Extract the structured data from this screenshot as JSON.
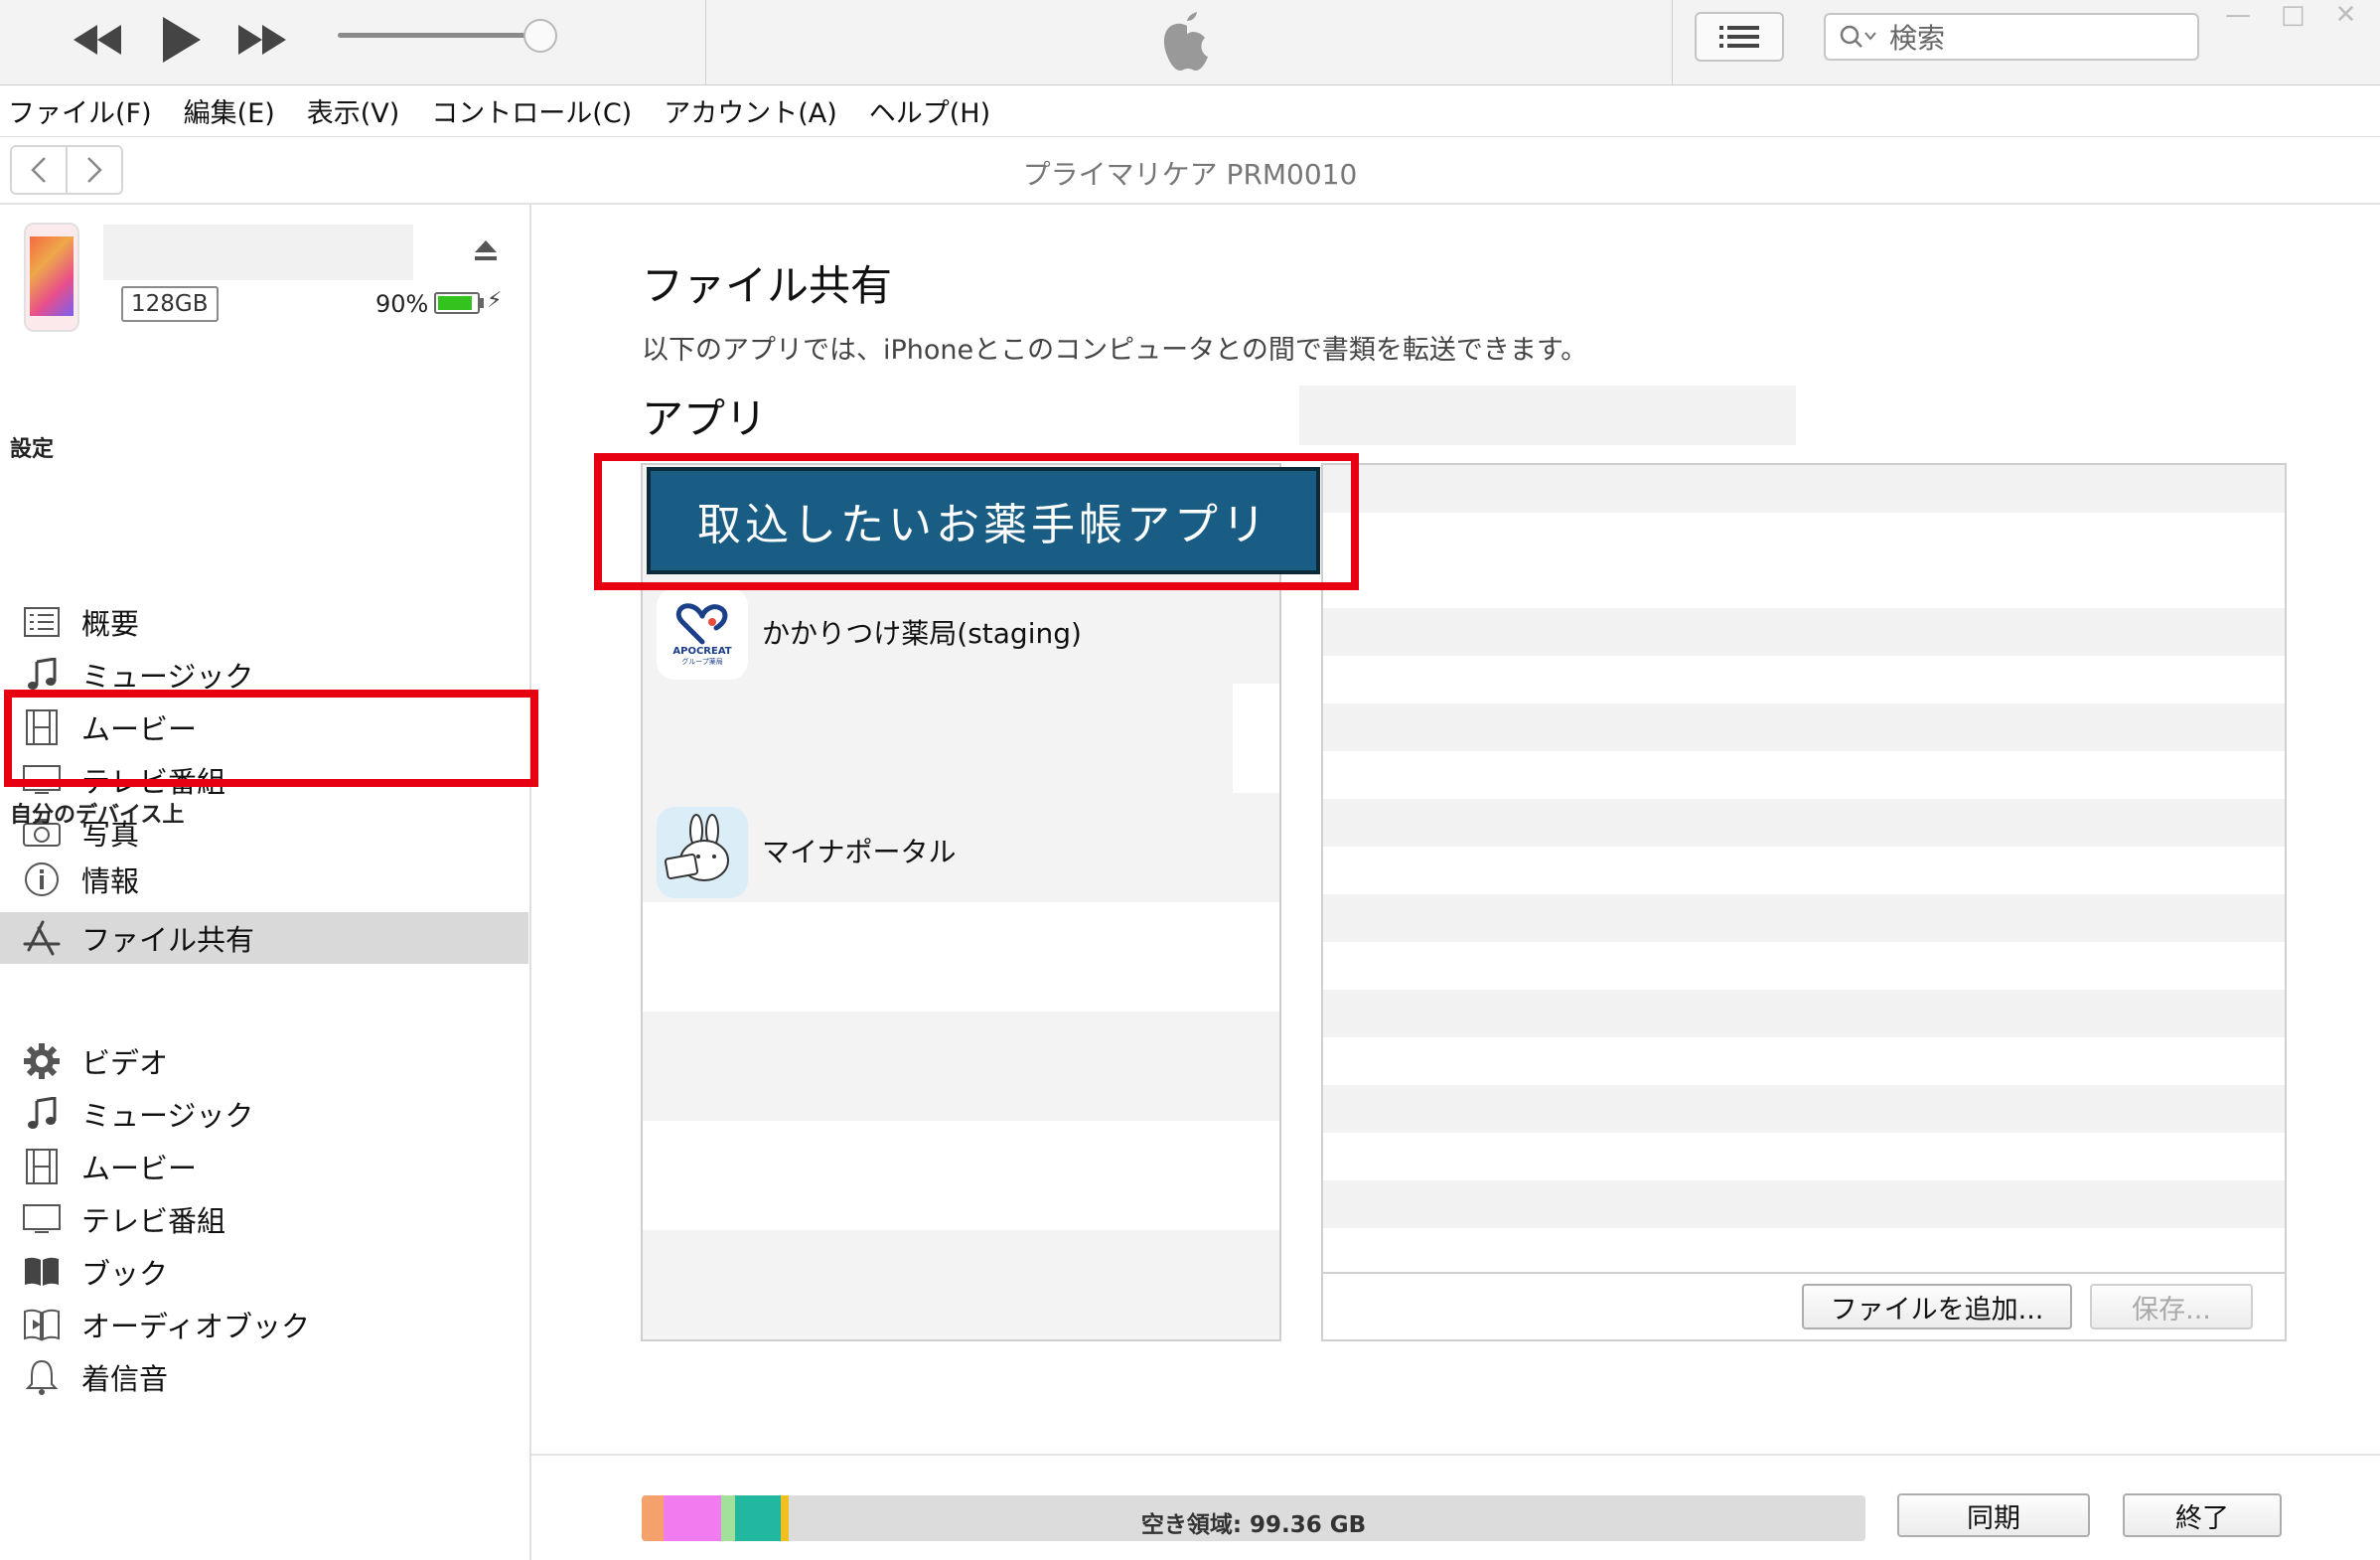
{
  "window": {
    "search_placeholder": "検索",
    "controls": [
      "—",
      "□",
      "✕"
    ]
  },
  "menu": [
    "ファイル(F)",
    "編集(E)",
    "表示(V)",
    "コントロール(C)",
    "アカウント(A)",
    "ヘルプ(H)"
  ],
  "nav": {
    "device_title": "プライマリケア PRM0010"
  },
  "device": {
    "capacity": "128GB",
    "battery": "90%",
    "battery_level": 0.9
  },
  "sidebar": {
    "settings_head": "設定",
    "settings_items": [
      {
        "label": "概要",
        "icon": "summary-icon"
      },
      {
        "label": "ミュージック",
        "icon": "music-icon"
      },
      {
        "label": "ムービー",
        "icon": "film-icon"
      },
      {
        "label": "テレビ番組",
        "icon": "tv-icon"
      },
      {
        "label": "写真",
        "icon": "camera-icon"
      },
      {
        "label": "情報",
        "icon": "info-icon"
      },
      {
        "label": "ファイル共有",
        "icon": "appstore-icon"
      }
    ],
    "device_head": "自分のデバイス上",
    "device_items": [
      {
        "label": "ビデオ",
        "icon": "gear-icon"
      },
      {
        "label": "ミュージック",
        "icon": "music-icon"
      },
      {
        "label": "ムービー",
        "icon": "film-icon"
      },
      {
        "label": "テレビ番組",
        "icon": "tv-icon"
      },
      {
        "label": "ブック",
        "icon": "book-icon"
      },
      {
        "label": "オーディオブック",
        "icon": "audiobook-icon"
      },
      {
        "label": "着信音",
        "icon": "bell-icon"
      }
    ]
  },
  "main": {
    "title": "ファイル共有",
    "description": "以下のアプリでは、iPhoneとこのコンピュータとの間で書類を転送できます。",
    "apps_head": "アプリ",
    "callout": "取込したいお薬手帳アプリ",
    "apps": [
      {
        "name": "かかりつけ薬局(staging)",
        "icon_text": "APOCREAT",
        "icon_subtext": "グループ薬局"
      },
      {
        "name": "マイナポータル"
      }
    ],
    "add_file_button": "ファイルを追加...",
    "save_button": "保存..."
  },
  "footer": {
    "free_space": "空き領域: 99.36 GB",
    "sync_button": "同期",
    "done_button": "終了",
    "storage_colors": [
      "#f4a16b",
      "#f07cf0",
      "#a3e09a",
      "#22b8a0",
      "#f0c020"
    ]
  }
}
